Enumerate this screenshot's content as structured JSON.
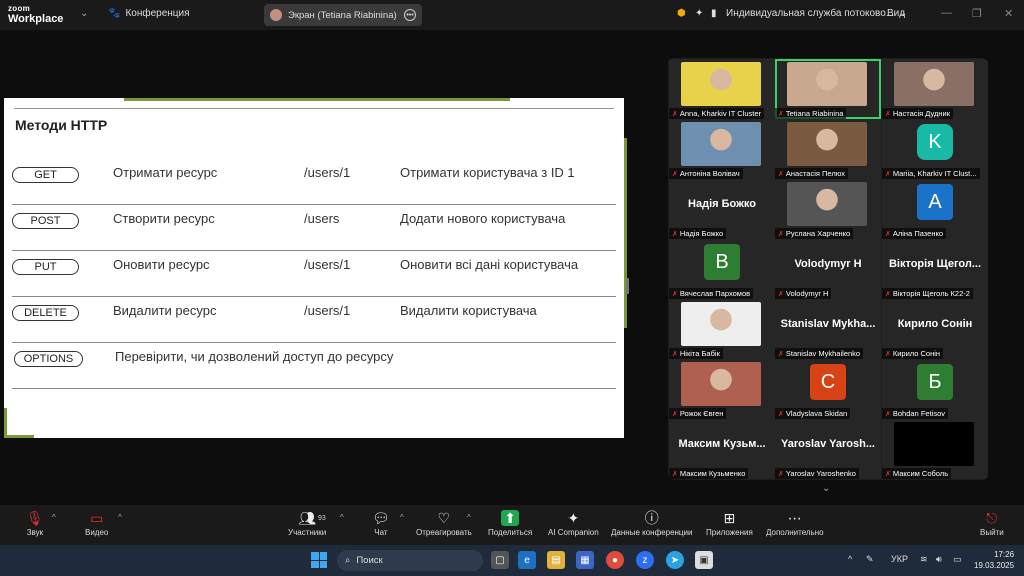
{
  "topbar": {
    "logo_line1": "zoom",
    "logo_line2": "Workplace",
    "meeting_label": "Конференция",
    "screen_share_label": "Экран (Tetiana Riabinina)",
    "sound_source": "Индивидуальная служба потоково...",
    "view_label": "Вид"
  },
  "slide": {
    "title": "Методи HTTP",
    "rows": [
      {
        "method": "GET",
        "action": "Отримати ресурс",
        "path": "/users/1",
        "description": "Отримати користувача з ID 1"
      },
      {
        "method": "POST",
        "action": "Створити ресурс",
        "path": "/users",
        "description": "Додати нового користувача"
      },
      {
        "method": "PUT",
        "action": "Оновити ресурс",
        "path": "/users/1",
        "description": "Оновити всі дані користувача"
      },
      {
        "method": "DELETE",
        "action": "Видалити ресурс",
        "path": "/users/1",
        "description": "Видалити користувача"
      },
      {
        "method": "OPTIONS",
        "action": "Перевірити, чи дозволений доступ до ресурсу",
        "path": "",
        "description": ""
      }
    ]
  },
  "gallery": {
    "participants": [
      {
        "name": "Anna, Kharkiv IT Cluster",
        "kind": "photo",
        "color": "#e8d24a"
      },
      {
        "name": "Tetiana Riabinina",
        "kind": "photo",
        "color": "#c9a890",
        "active": true
      },
      {
        "name": "Настасія Дудник",
        "kind": "photo",
        "color": "#8a6f64"
      },
      {
        "name": "Антоніна Волівач",
        "kind": "photo",
        "color": "#6f8fb0"
      },
      {
        "name": "Анастасія Пелюх",
        "kind": "photo",
        "color": "#7a5a40"
      },
      {
        "name": "Mariia, Kharkiv IT Clust...",
        "kind": "logo",
        "color": "#18b9a6",
        "letter": "K"
      },
      {
        "name": "Надія Божко",
        "kind": "text",
        "display": "Надія Божко"
      },
      {
        "name": "Руслана Харченко",
        "kind": "photo",
        "color": "#555555"
      },
      {
        "name": "Аліна Пазенко",
        "kind": "letter",
        "color": "#1a73c8",
        "letter": "A"
      },
      {
        "name": "Вячеслав Пархомов",
        "kind": "letter",
        "color": "#2e7d32",
        "letter": "В"
      },
      {
        "name": "Volodymyr H",
        "kind": "text",
        "display": "Volodymyr H"
      },
      {
        "name": "Вікторія Щеголь К22-2",
        "kind": "text",
        "display": "Вікторія Щегол..."
      },
      {
        "name": "Нікіта Бабік",
        "kind": "photo",
        "color": "#eeeeee"
      },
      {
        "name": "Stanislav Mykhailenko",
        "kind": "text",
        "display": "Stanislav Mykha..."
      },
      {
        "name": "Кирило Сонін",
        "kind": "text",
        "display": "Кирило Сонін"
      },
      {
        "name": "Рожок Євген",
        "kind": "photo",
        "color": "#b06050"
      },
      {
        "name": "Vladyslava Skidan",
        "kind": "letter",
        "color": "#d84315",
        "letter": "C"
      },
      {
        "name": "Bohdan Fetisov",
        "kind": "letter",
        "color": "#2e7d32",
        "letter": "Б"
      },
      {
        "name": "Максим Кузьменко",
        "kind": "text",
        "display": "Максим Кузьм..."
      },
      {
        "name": "Yaroslav Yaroshenko",
        "kind": "text",
        "display": "Yaroslav Yarosh..."
      },
      {
        "name": "Максим Соболь",
        "kind": "black",
        "color": "#000000"
      }
    ]
  },
  "toolbar": {
    "audio": "Звук",
    "video": "Видео",
    "participants": "Участники",
    "participants_count": "93",
    "chat": "Чат",
    "react": "Отреагировать",
    "share": "Поделиться",
    "ai": "AI Companion",
    "meeting_info": "Данные конференции",
    "apps": "Приложения",
    "more": "Дополнительно",
    "leave": "Выйти"
  },
  "taskbar": {
    "search_placeholder": "Поиск",
    "language": "УКР",
    "time": "17:26",
    "date": "19.03.2025"
  },
  "colors": {
    "accent_green": "#7a9a3a",
    "active_speaker": "#3ccf6c",
    "muted_red": "#e03030"
  }
}
